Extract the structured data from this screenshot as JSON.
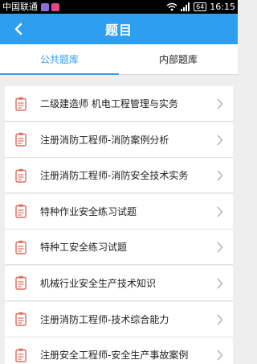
{
  "status_bar": {
    "carrier": "中国联通",
    "battery": "64",
    "time": "16:15"
  },
  "header": {
    "title": "题目"
  },
  "tabs": [
    {
      "label": "公共题库",
      "active": true
    },
    {
      "label": "内部题库",
      "active": false
    }
  ],
  "items": [
    {
      "label": "二级建造师 机电工程管理与实务"
    },
    {
      "label": "注册消防工程师-消防案例分析"
    },
    {
      "label": "注册消防工程师-消防安全技术实务"
    },
    {
      "label": "特种作业安全练习试题"
    },
    {
      "label": "特种工安全练习试题"
    },
    {
      "label": "机械行业安全生产技术知识"
    },
    {
      "label": "注册消防工程师-技术综合能力"
    },
    {
      "label": "注册安全工程师-安全生产事故案例"
    }
  ],
  "colors": {
    "accent": "#2e9ef0",
    "icon": "#e06a5a"
  }
}
